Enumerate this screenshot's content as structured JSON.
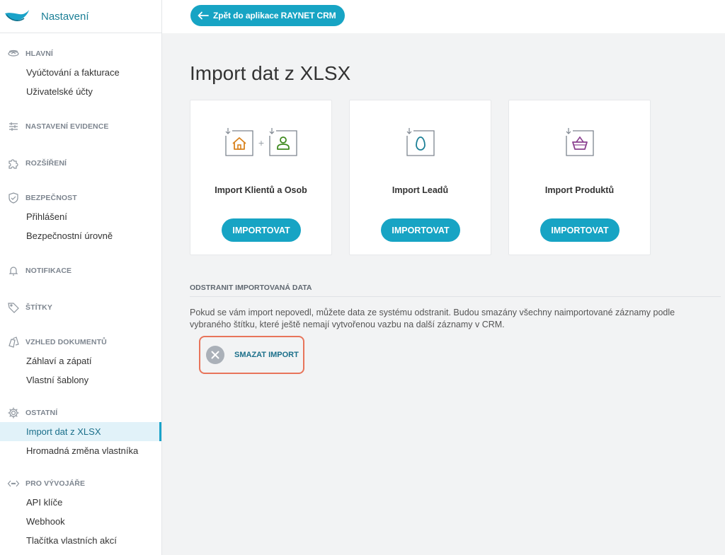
{
  "brand": {
    "title": "Nastavení",
    "logo_icon": "raynet-wave-logo"
  },
  "topbar": {
    "back_label": "Zpět do aplikace RAYNET CRM"
  },
  "sidebar": {
    "sections": [
      {
        "label": "HLAVNÍ",
        "icon": "layers-icon",
        "items": [
          "Vyúčtování a fakturace",
          "Uživatelské účty"
        ]
      },
      {
        "label": "NASTAVENÍ EVIDENCE",
        "icon": "sliders-icon",
        "items": []
      },
      {
        "label": "ROZŠÍŘENÍ",
        "icon": "puzzle-icon",
        "items": []
      },
      {
        "label": "BEZPEČNOST",
        "icon": "shield-icon",
        "items": [
          "Přihlášení",
          "Bezpečnostní úrovně"
        ]
      },
      {
        "label": "NOTIFIKACE",
        "icon": "bell-icon",
        "items": []
      },
      {
        "label": "ŠTÍTKY",
        "icon": "tag-icon",
        "items": []
      },
      {
        "label": "VZHLED DOKUMENTŮ",
        "icon": "documents-icon",
        "items": [
          "Záhlaví a zápatí",
          "Vlastní šablony"
        ]
      },
      {
        "label": "OSTATNÍ",
        "icon": "gear-icon",
        "items": [
          "Import dat z XLSX",
          "Hromadná změna vlastníka"
        ]
      },
      {
        "label": "PRO VÝVOJÁŘE",
        "icon": "code-icon",
        "items": [
          "API klíče",
          "Webhook",
          "Tlačítka vlastních akcí"
        ]
      }
    ],
    "active_item": "Import dat z XLSX"
  },
  "main": {
    "title": "Import dat z XLSX",
    "cards": [
      {
        "title": "Import Klientů a Osob",
        "button": "IMPORTOVAT",
        "icons": [
          "import-home-icon",
          "import-person-icon"
        ],
        "plus": "+"
      },
      {
        "title": "Import Leadů",
        "button": "IMPORTOVAT",
        "icons": [
          "import-egg-icon"
        ]
      },
      {
        "title": "Import Produktů",
        "button": "IMPORTOVAT",
        "icons": [
          "import-basket-icon"
        ]
      }
    ],
    "delete": {
      "heading": "ODSTRANIT IMPORTOVANÁ DATA",
      "text": "Pokud se vám import nepovedl, můžete data ze systému odstranit. Budou smazány všechny naimportované záznamy podle vybraného štítku, které ještě nemají vytvořenou vazbu na další záznamy v CRM.",
      "button": "SMAZAT IMPORT"
    }
  },
  "colors": {
    "accent": "#17a4c4",
    "highlight": "#e8745a",
    "home": "#d9831f",
    "person": "#3f8a1f",
    "egg": "#1b7f96",
    "basket": "#8a3f8f"
  }
}
